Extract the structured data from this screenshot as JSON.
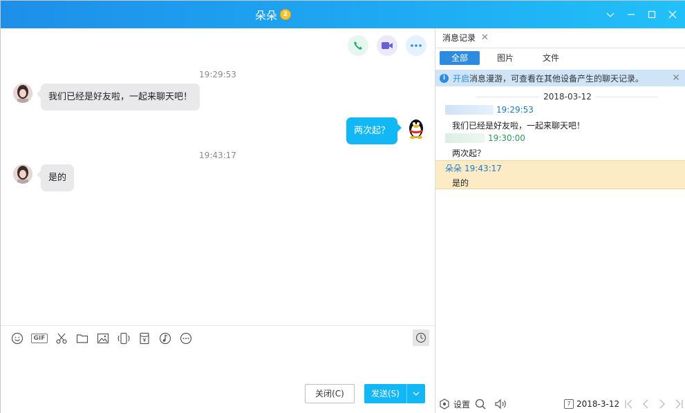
{
  "window": {
    "title": "朵朵",
    "vip_level": "2"
  },
  "colors": {
    "titlebar_left": "#1e8fe9",
    "titlebar_right": "#22c0f8",
    "accent": "#12b7f5",
    "highlight": "#fdebc5"
  },
  "call_bar": {
    "phone_icon": "phone-icon",
    "video_icon": "video-icon",
    "more_icon": "more-icon"
  },
  "messages": [
    {
      "timestamp": "19:29:53"
    },
    {
      "sender": "friend",
      "text": "我们已经是好友啦，一起来聊天吧！"
    },
    {
      "sender": "me",
      "text": "两次起？"
    },
    {
      "timestamp": "19:43:17"
    },
    {
      "sender": "friend",
      "text": "是的"
    }
  ],
  "toolbar": {
    "gif_label": "GIF",
    "icons": [
      "emoji-icon",
      "gif-icon",
      "scissors-icon",
      "folder-icon",
      "image-icon",
      "shake-icon",
      "red-packet-icon",
      "music-icon",
      "more-icon"
    ]
  },
  "buttons": {
    "close": "关闭(C)",
    "send": "发送(S)"
  },
  "history": {
    "tab_label": "消息记录",
    "filters": [
      "全部",
      "图片",
      "文件"
    ],
    "notice_link": "开启",
    "notice_text": "消息漫游，可查看在其他设备产生的聊天记录。",
    "date": "2018-03-12",
    "records": [
      {
        "time": "19:29:53",
        "text": "我们已经是好友啦，一起来聊天吧！"
      },
      {
        "time": "19:30:00",
        "text": "两次起？"
      },
      {
        "name": "朵朵",
        "time": "19:43:17",
        "text": "是的"
      }
    ],
    "footer": {
      "settings": "设置",
      "cal_day": "7",
      "date": "2018-3-12"
    }
  }
}
